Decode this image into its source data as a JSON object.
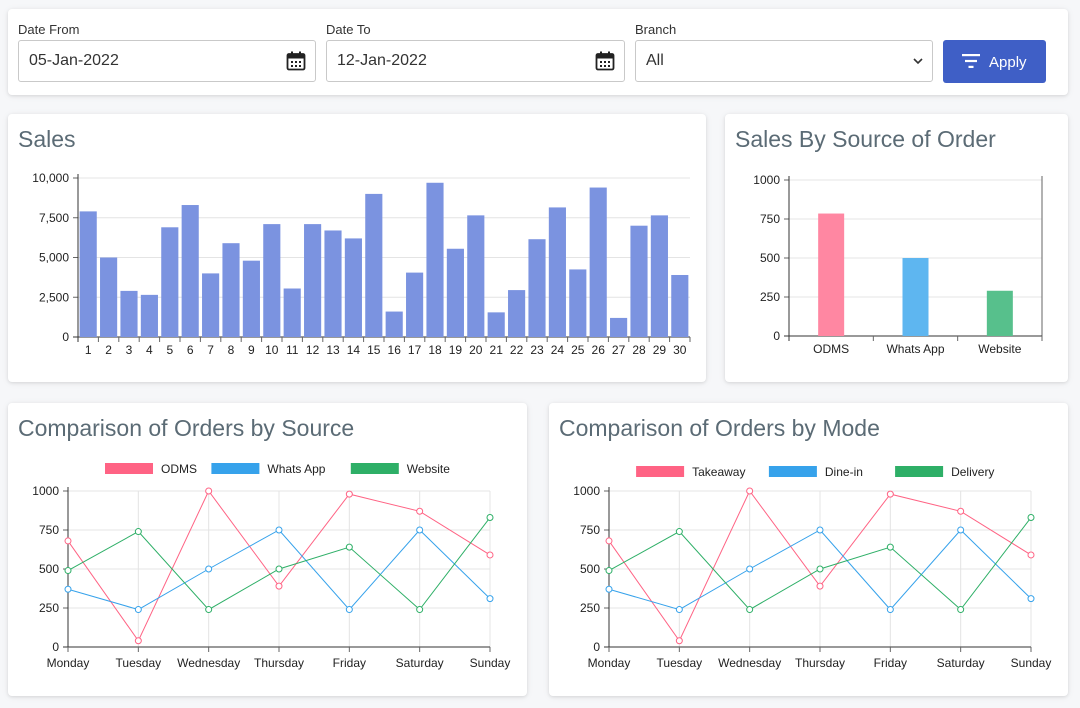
{
  "filters": {
    "date_from": {
      "label": "Date From",
      "value": "05-Jan-2022"
    },
    "date_to": {
      "label": "Date To",
      "value": "12-Jan-2022"
    },
    "branch": {
      "label": "Branch",
      "value": "All"
    },
    "apply_label": "Apply"
  },
  "colors": {
    "accent": "#3f5fc6"
  },
  "chart_data": [
    {
      "type": "bar",
      "title": "Sales",
      "categories": [
        "1",
        "2",
        "3",
        "4",
        "5",
        "6",
        "7",
        "8",
        "9",
        "10",
        "11",
        "12",
        "13",
        "14",
        "15",
        "16",
        "17",
        "18",
        "19",
        "20",
        "21",
        "22",
        "23",
        "24",
        "25",
        "26",
        "27",
        "28",
        "29",
        "30"
      ],
      "values": [
        7900,
        5000,
        2900,
        2650,
        6900,
        8300,
        4000,
        5900,
        4800,
        7100,
        3050,
        7100,
        6700,
        6200,
        9000,
        1600,
        4050,
        9700,
        5550,
        7650,
        1550,
        2950,
        6150,
        8150,
        4250,
        9400,
        1200,
        7000,
        7650,
        3900
      ],
      "ylim": [
        0,
        10000
      ],
      "yticks": [
        0,
        2500,
        5000,
        7500,
        10000
      ],
      "ytick_labels": [
        "0",
        "2,500",
        "5,000",
        "7,500",
        "10,000"
      ],
      "color": "#7b93e0",
      "grid": true
    },
    {
      "type": "bar",
      "title": "Sales By Source of Order",
      "categories": [
        "ODMS",
        "Whats App",
        "Website"
      ],
      "values": [
        785,
        500,
        290
      ],
      "colors": [
        "#ff87a2",
        "#5eb6f0",
        "#57c08c"
      ],
      "ylim": [
        0,
        1000
      ],
      "yticks": [
        0,
        250,
        500,
        750,
        1000
      ],
      "ytick_labels": [
        "0",
        "250",
        "500",
        "750",
        "1000"
      ],
      "grid": true
    },
    {
      "type": "line",
      "title": "Comparison of Orders by Source",
      "categories": [
        "Monday",
        "Tuesday",
        "Wednesday",
        "Thursday",
        "Friday",
        "Saturday",
        "Sunday"
      ],
      "series": [
        {
          "name": "ODMS",
          "color": "#ff6384",
          "values": [
            680,
            40,
            1000,
            390,
            980,
            870,
            590
          ]
        },
        {
          "name": "Whats App",
          "color": "#36a2eb",
          "values": [
            370,
            240,
            500,
            750,
            240,
            750,
            310
          ]
        },
        {
          "name": "Website",
          "color": "#2eaf67",
          "values": [
            490,
            740,
            240,
            500,
            640,
            240,
            830
          ]
        }
      ],
      "ylim": [
        0,
        1000
      ],
      "yticks": [
        0,
        250,
        500,
        750,
        1000
      ],
      "ytick_labels": [
        "0",
        "250",
        "500",
        "750",
        "1000"
      ],
      "legend": "top",
      "grid": true
    },
    {
      "type": "line",
      "title": "Comparison of Orders by Mode",
      "categories": [
        "Monday",
        "Tuesday",
        "Wednesday",
        "Thursday",
        "Friday",
        "Saturday",
        "Sunday"
      ],
      "series": [
        {
          "name": "Takeaway",
          "color": "#ff6384",
          "values": [
            680,
            40,
            1000,
            390,
            980,
            870,
            590
          ]
        },
        {
          "name": "Dine-in",
          "color": "#36a2eb",
          "values": [
            370,
            240,
            500,
            750,
            240,
            750,
            310
          ]
        },
        {
          "name": "Delivery",
          "color": "#2eaf67",
          "values": [
            490,
            740,
            240,
            500,
            640,
            240,
            830
          ]
        }
      ],
      "ylim": [
        0,
        1000
      ],
      "yticks": [
        0,
        250,
        500,
        750,
        1000
      ],
      "ytick_labels": [
        "0",
        "250",
        "500",
        "750",
        "1000"
      ],
      "legend": "top",
      "grid": true
    }
  ]
}
